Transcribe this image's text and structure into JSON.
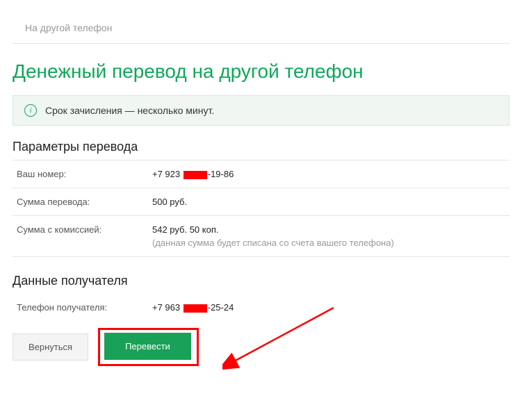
{
  "search": {
    "placeholder": "На другой телефон"
  },
  "title": "Денежный перевод на другой телефон",
  "banner": {
    "text": "Срок зачисления — несколько минут."
  },
  "params": {
    "heading": "Параметры перевода",
    "senderLabel": "Ваш номер:",
    "senderPrefix": "+7 923 ",
    "senderSuffix": "-19-86",
    "amountLabel": "Сумма перевода:",
    "amountValue": "500 руб.",
    "feeLabel": "Сумма с комиссией:",
    "feeValue": "542 руб. 50 коп.",
    "feeNote": "(данная сумма будет списана со счета вашего телефона)"
  },
  "recipient": {
    "heading": "Данные получателя",
    "phoneLabel": "Телефон получателя:",
    "phonePrefix": "+7 963 ",
    "phoneSuffix": "-25-24"
  },
  "buttons": {
    "back": "Вернуться",
    "submit": "Перевести"
  }
}
